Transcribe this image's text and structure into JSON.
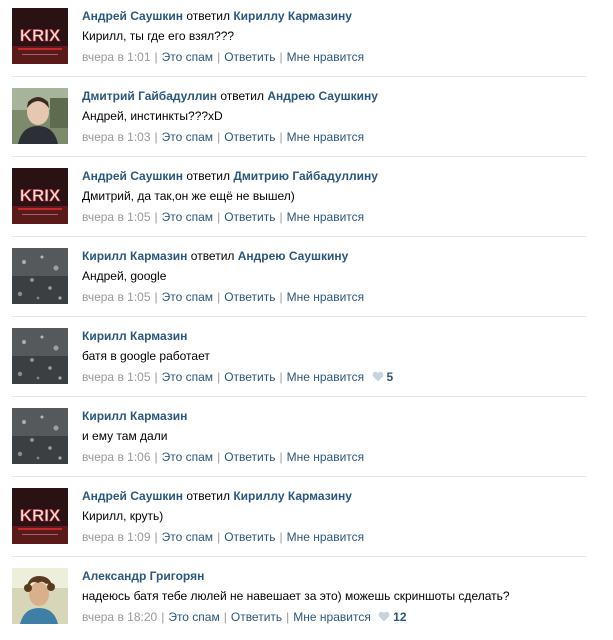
{
  "colors": {
    "link": "#2b587a",
    "meta": "#999999",
    "separator": "#e1e6eb",
    "heart": "#c7d3df"
  },
  "labels": {
    "spam": "Это спам",
    "reply": "Ответить",
    "like": "Мне нравится"
  },
  "comments": [
    {
      "avatar": "skrillex-logo-avatar",
      "author": "Андрей Саушкин",
      "verb": "ответил",
      "target": "Кириллу Кармазину",
      "text": "Кирилл, ты где его взял???",
      "time": "вчера в 1:01",
      "likes": ""
    },
    {
      "avatar": "portrait-photo-avatar",
      "author": "Дмитрий Гайбадуллин",
      "verb": "ответил",
      "target": "Андрею Саушкину",
      "text": "Андрей, инстинкты???xD",
      "time": "вчера в 1:03",
      "likes": ""
    },
    {
      "avatar": "skrillex-logo-avatar",
      "author": "Андрей Саушкин",
      "verb": "ответил",
      "target": "Дмитрию Гайбадуллину",
      "text": "Дмитрий, да так,он же ещё не вышел)",
      "time": "вчера в 1:05",
      "likes": ""
    },
    {
      "avatar": "rain-drops-avatar",
      "author": "Кирилл Кармазин",
      "verb": "ответил",
      "target": "Андрею Саушкину",
      "text": "Андрей, google",
      "time": "вчера в 1:05",
      "likes": ""
    },
    {
      "avatar": "rain-drops-avatar",
      "author": "Кирилл Кармазин",
      "verb": "",
      "target": "",
      "text": "батя в google работает",
      "time": "вчера в 1:05",
      "likes": "5"
    },
    {
      "avatar": "rain-drops-avatar",
      "author": "Кирилл Кармазин",
      "verb": "",
      "target": "",
      "text": "и ему там дали",
      "time": "вчера в 1:06",
      "likes": ""
    },
    {
      "avatar": "skrillex-logo-avatar",
      "author": "Андрей Саушкин",
      "verb": "ответил",
      "target": "Кириллу Кармазину",
      "text": "Кирилл, круть)",
      "time": "вчера в 1:09",
      "likes": ""
    },
    {
      "avatar": "curly-hair-portrait-avatar",
      "author": "Александр Григорян",
      "verb": "",
      "target": "",
      "text": "надеюсь батя тебе люлей не навешает за это) можешь скриншоты сделать?",
      "time": "вчера в 18:20",
      "likes": "12"
    }
  ]
}
